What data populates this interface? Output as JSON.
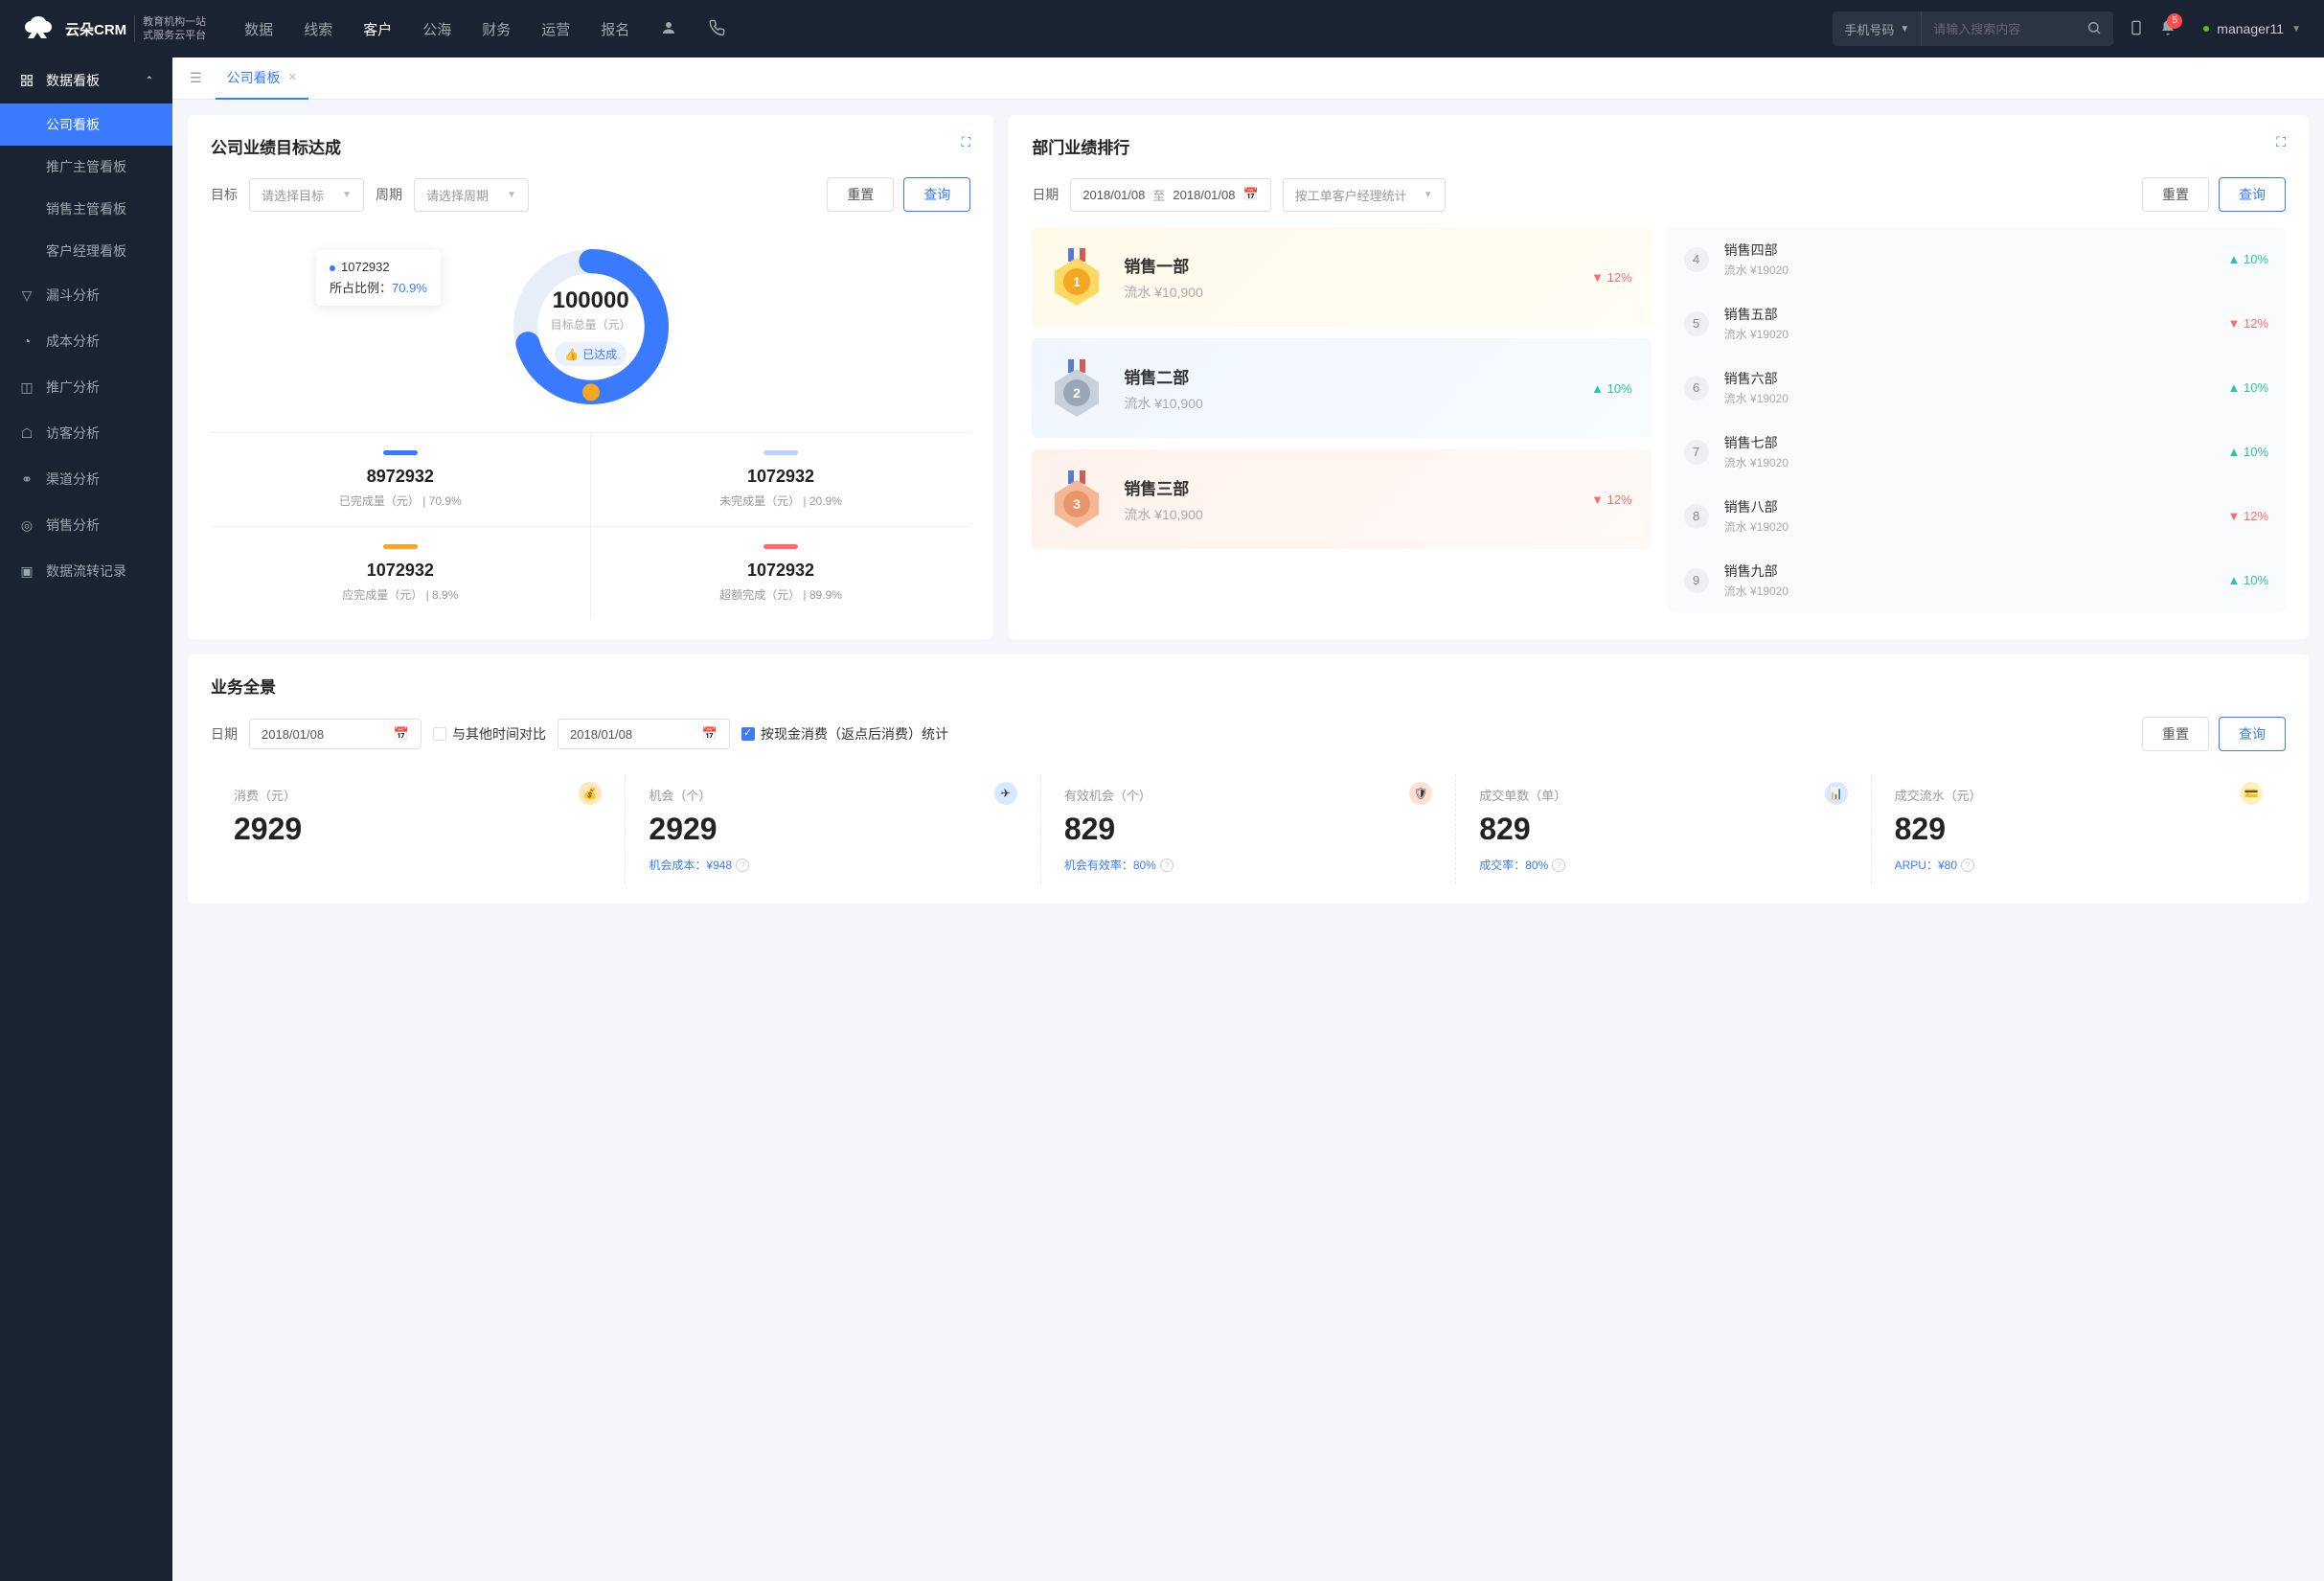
{
  "brand": {
    "name": "云朵CRM",
    "sub1": "教育机构一站",
    "sub2": "式服务云平台"
  },
  "topnav": [
    "数据",
    "线索",
    "客户",
    "公海",
    "财务",
    "运营",
    "报名"
  ],
  "topnav_active": 2,
  "search": {
    "type": "手机号码",
    "placeholder": "请输入搜索内容"
  },
  "notif_count": "5",
  "user": "manager11",
  "sidebar": {
    "group": "数据看板",
    "subs": [
      "公司看板",
      "推广主管看板",
      "销售主管看板",
      "客户经理看板"
    ],
    "active_sub": 0,
    "items": [
      "漏斗分析",
      "成本分析",
      "推广分析",
      "访客分析",
      "渠道分析",
      "销售分析",
      "数据流转记录"
    ]
  },
  "tab": {
    "label": "公司看板"
  },
  "target": {
    "title": "公司业绩目标达成",
    "label_target": "目标",
    "select_target": "请选择目标",
    "label_period": "周期",
    "select_period": "请选择周期",
    "btn_reset": "重置",
    "btn_query": "查询",
    "tooltip_val": "1072932",
    "tooltip_lbl": "所占比例：",
    "tooltip_pct": "70.9%",
    "center_val": "100000",
    "center_lbl": "目标总量（元）",
    "badge": "已达成",
    "stats": [
      {
        "color": "#3a7afe",
        "val": "8972932",
        "lbl": "已完成量（元） | 70.9%"
      },
      {
        "color": "#b9d4ff",
        "val": "1072932",
        "lbl": "未完成量（元） | 20.9%"
      },
      {
        "color": "#f5a623",
        "val": "1072932",
        "lbl": "应完成量（元） | 8.9%"
      },
      {
        "color": "#ff6b6b",
        "val": "1072932",
        "lbl": "超额完成（元） | 89.9%"
      }
    ]
  },
  "rank": {
    "title": "部门业绩排行",
    "label_date": "日期",
    "date_from": "2018/01/08",
    "date_sep": "至",
    "date_to": "2018/01/08",
    "stat_by": "按工单客户经理统计",
    "btn_reset": "重置",
    "btn_query": "查询",
    "top3": [
      {
        "name": "销售一部",
        "amount": "流水 ¥10,900",
        "pct": "12%",
        "dir": "down"
      },
      {
        "name": "销售二部",
        "amount": "流水 ¥10,900",
        "pct": "10%",
        "dir": "up"
      },
      {
        "name": "销售三部",
        "amount": "流水 ¥10,900",
        "pct": "12%",
        "dir": "down"
      }
    ],
    "rest": [
      {
        "n": "4",
        "name": "销售四部",
        "amount": "流水 ¥19020",
        "pct": "10%",
        "dir": "up"
      },
      {
        "n": "5",
        "name": "销售五部",
        "amount": "流水 ¥19020",
        "pct": "12%",
        "dir": "down"
      },
      {
        "n": "6",
        "name": "销售六部",
        "amount": "流水 ¥19020",
        "pct": "10%",
        "dir": "up"
      },
      {
        "n": "7",
        "name": "销售七部",
        "amount": "流水 ¥19020",
        "pct": "10%",
        "dir": "up"
      },
      {
        "n": "8",
        "name": "销售八部",
        "amount": "流水 ¥19020",
        "pct": "12%",
        "dir": "down"
      },
      {
        "n": "9",
        "name": "销售九部",
        "amount": "流水 ¥19020",
        "pct": "10%",
        "dir": "up"
      }
    ]
  },
  "biz": {
    "title": "业务全景",
    "label_date": "日期",
    "date1": "2018/01/08",
    "compare_lbl": "与其他时间对比",
    "date2": "2018/01/08",
    "check_lbl": "按现金消费（返点后消费）统计",
    "btn_reset": "重置",
    "btn_query": "查询",
    "cards": [
      {
        "lbl": "消费（元）",
        "val": "2929",
        "sub": ""
      },
      {
        "lbl": "机会（个）",
        "val": "2929",
        "sub": "机会成本：¥948"
      },
      {
        "lbl": "有效机会（个）",
        "val": "829",
        "sub": "机会有效率：80%"
      },
      {
        "lbl": "成交单数（单）",
        "val": "829",
        "sub": "成交率：80%"
      },
      {
        "lbl": "成交流水（元）",
        "val": "829",
        "sub": "ARPU：¥80"
      }
    ]
  },
  "chart_data": {
    "type": "pie",
    "title": "目标总量（元）",
    "total": 100000,
    "series": [
      {
        "name": "已完成量",
        "value": 8972932,
        "percent": 70.9,
        "color": "#3a7afe"
      },
      {
        "name": "未完成量",
        "value": 1072932,
        "percent": 20.9,
        "color": "#b9d4ff"
      },
      {
        "name": "应完成量",
        "value": 1072932,
        "percent": 8.9,
        "color": "#f5a623"
      },
      {
        "name": "超额完成",
        "value": 1072932,
        "percent": 89.9,
        "color": "#ff6b6b"
      }
    ]
  }
}
